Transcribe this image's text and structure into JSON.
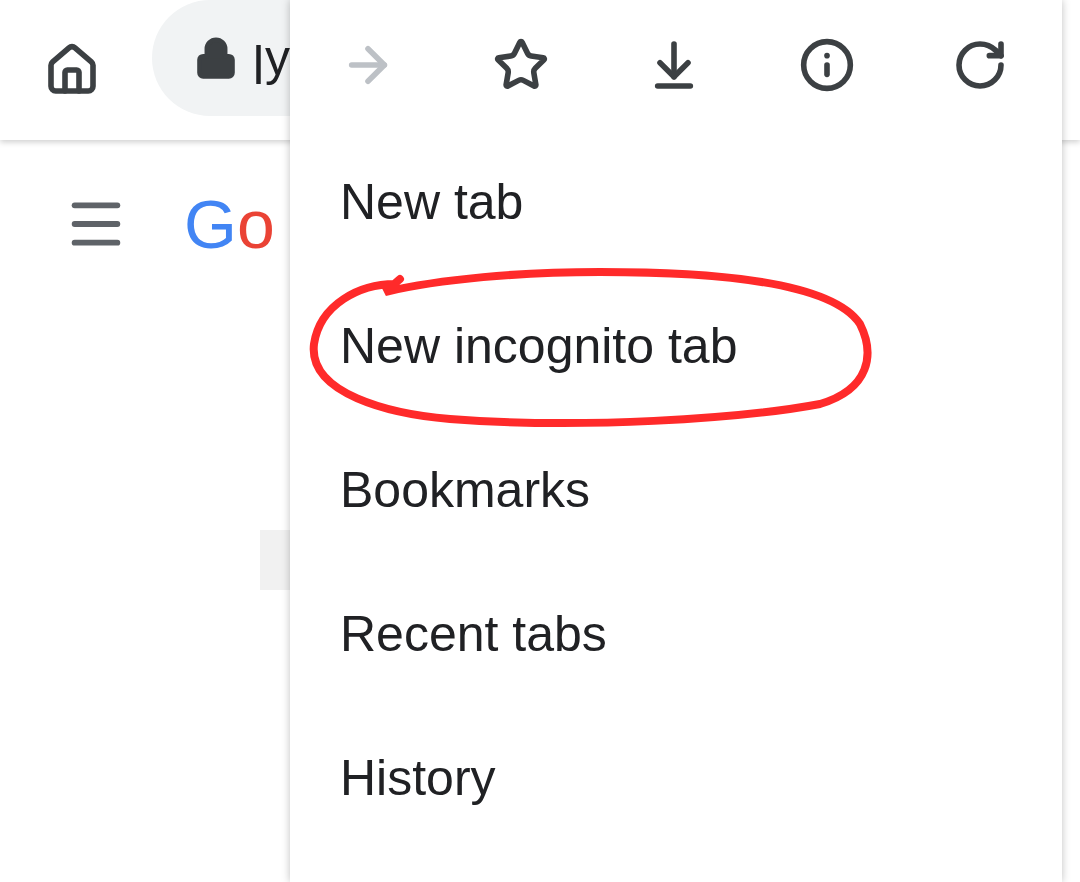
{
  "address_bar": {
    "url": "ןy"
  },
  "page": {
    "logo": [
      {
        "char": "G",
        "color": "#4285f4"
      },
      {
        "char": "o",
        "color": "#ea4335"
      }
    ]
  },
  "menu": {
    "toolbar": [
      {
        "kind": "forward",
        "disabled": true
      },
      {
        "kind": "bookmark",
        "disabled": false
      },
      {
        "kind": "download",
        "disabled": false
      },
      {
        "kind": "info",
        "disabled": false
      },
      {
        "kind": "reload",
        "disabled": false
      }
    ],
    "items": [
      {
        "label": "New tab",
        "circled": false
      },
      {
        "label": "New incognito tab",
        "circled": true
      },
      {
        "label": "Bookmarks",
        "circled": false
      },
      {
        "label": "Recent tabs",
        "circled": false
      },
      {
        "label": "History",
        "circled": false
      }
    ]
  }
}
